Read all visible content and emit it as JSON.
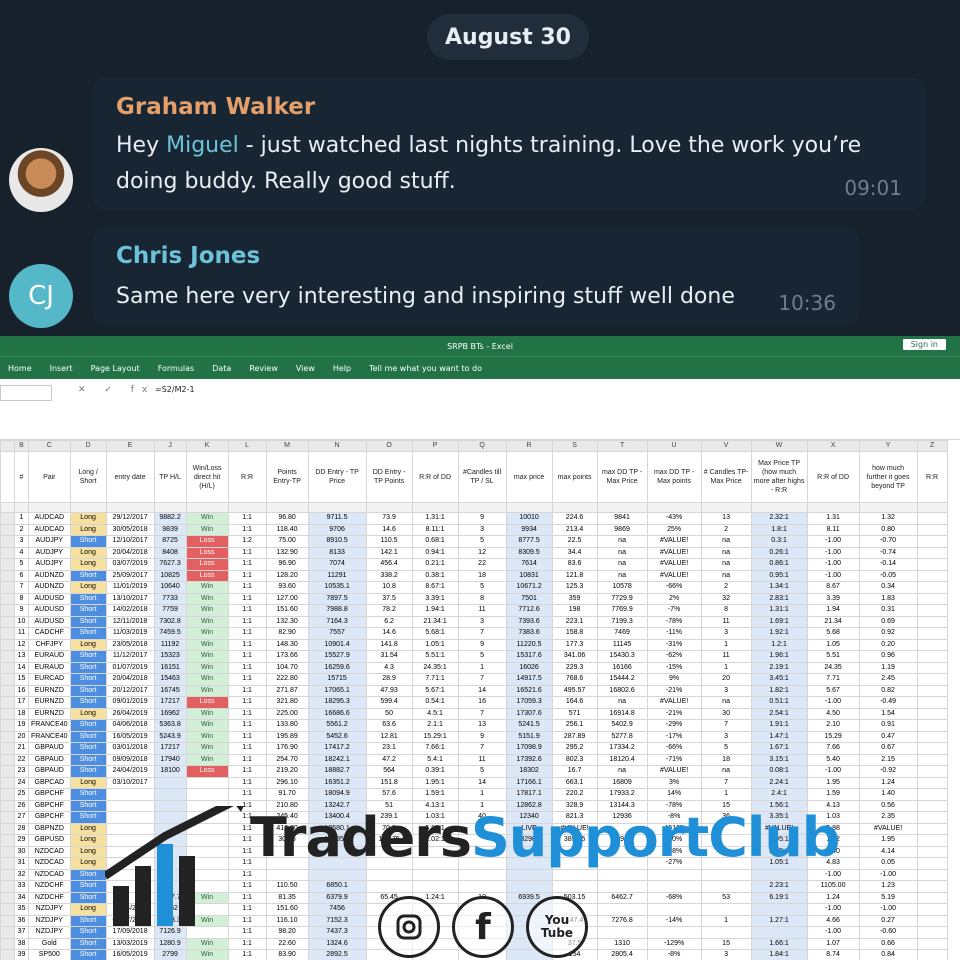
{
  "chat": {
    "date": "August 30",
    "messages": [
      {
        "sender": "Graham Walker",
        "text_before": "Hey ",
        "mention": "Miguel",
        "text_after": " - just watched last nights training. Love the work you’re doing buddy. Really good stuff.",
        "time": "09:01"
      },
      {
        "sender": "Chris Jones",
        "avatar_initials": "CJ",
        "text": "Same here very interesting and inspiring stuff well done",
        "time": "10:36"
      }
    ]
  },
  "excel": {
    "title": "SRPB BTs  -  Excel",
    "signin": "Sign in",
    "ribbon_tabs": [
      "Home",
      "Insert",
      "Page Layout",
      "Formulas",
      "Data",
      "Review",
      "View",
      "Help",
      "Tell me what you want to do"
    ],
    "formula": "=S2/M2-1",
    "fx_icons": "✕ ✓ fx",
    "column_letters": [
      "B",
      "C",
      "D",
      "E",
      "J",
      "K",
      "L",
      "M",
      "N",
      "O",
      "P",
      "Q",
      "R",
      "S",
      "T",
      "U",
      "V",
      "W",
      "X",
      "Y",
      "Z"
    ],
    "headers": [
      "#",
      "Pair",
      "Long / Short",
      "entry date",
      "TP H/L",
      "Win/Loss direct hit (H/L)",
      "R:R",
      "Points Entry-TP",
      "DD Entry - TP Price",
      "DD Entry - TP Points",
      "R:R of DD",
      "#Candles till TP / SL",
      "max price",
      "max points",
      "max DD TP - Max Price",
      "max DD TP - Max points",
      "# Candles TP-Max Price",
      "Max Price TP (how much more after highs - R:R",
      "R:R of DD",
      "how much further it goes beyond TP",
      "R:R"
    ],
    "rows": [
      [
        "1",
        "AUDCAD",
        "Long",
        "29/12/2017",
        "9882.2",
        "Win",
        "1:1",
        "96.80",
        "9711.5",
        "73.9",
        "1.31:1",
        "9",
        "10010",
        "224.6",
        "9841",
        "-43%",
        "13",
        "2.32:1",
        "1.31",
        "1.32"
      ],
      [
        "2",
        "AUDCAD",
        "Long",
        "30/05/2018",
        "9839",
        "Win",
        "1:1",
        "118.40",
        "9706",
        "14.6",
        "8.11:1",
        "3",
        "9934",
        "213.4",
        "9869",
        "25%",
        "2",
        "1.8:1",
        "8.11",
        "0.80"
      ],
      [
        "3",
        "AUDJPY",
        "Short",
        "12/10/2017",
        "8725",
        "Loss",
        "1:2",
        "75.00",
        "8910.5",
        "110.5",
        "0.68:1",
        "5",
        "8777.5",
        "22.5",
        "na",
        "#VALUE!",
        "na",
        "0.3:1",
        "-1.00",
        "-0.70"
      ],
      [
        "4",
        "AUDJPY",
        "Long",
        "20/04/2018",
        "8408",
        "Loss",
        "1:1",
        "132.90",
        "8133",
        "142.1",
        "0.94:1",
        "12",
        "8309.5",
        "34.4",
        "na",
        "#VALUE!",
        "na",
        "0.26:1",
        "-1.00",
        "-0.74"
      ],
      [
        "5",
        "AUDJPY",
        "Long",
        "03/07/2019",
        "7627.3",
        "Loss",
        "1:1",
        "96.90",
        "7074",
        "456.4",
        "0.21:1",
        "22",
        "7614",
        "83.6",
        "na",
        "#VALUE!",
        "na",
        "0.86:1",
        "-1.00",
        "-0.14"
      ],
      [
        "6",
        "AUDNZD",
        "Short",
        "25/09/2017",
        "10825",
        "Loss",
        "1:1",
        "128.20",
        "11291",
        "338.2",
        "0.38:1",
        "18",
        "10831",
        "121.8",
        "na",
        "#VALUE!",
        "na",
        "0.95:1",
        "-1.00",
        "-0.05"
      ],
      [
        "7",
        "AUDNZD",
        "Long",
        "11/01/2019",
        "10640",
        "Win",
        "1:1",
        "93.60",
        "10535.1",
        "10.8",
        "8.67:1",
        "5",
        "10671.2",
        "125.3",
        "10578",
        "-66%",
        "2",
        "1.34:1",
        "8.67",
        "0.34"
      ],
      [
        "8",
        "AUDUSD",
        "Short",
        "13/10/2017",
        "7733",
        "Win",
        "1:1",
        "127.00",
        "7897.5",
        "37.5",
        "3.39:1",
        "8",
        "7501",
        "359",
        "7729.9",
        "2%",
        "32",
        "2.83:1",
        "3.39",
        "1.83"
      ],
      [
        "9",
        "AUDUSD",
        "Short",
        "14/02/2018",
        "7759",
        "Win",
        "1:1",
        "151.60",
        "7988.8",
        "78.2",
        "1.94:1",
        "11",
        "7712.6",
        "198",
        "7769.9",
        "-7%",
        "8",
        "1.31:1",
        "1.94",
        "0.31"
      ],
      [
        "10",
        "AUDUSD",
        "Short",
        "12/11/2018",
        "7302.8",
        "Win",
        "1:1",
        "132.30",
        "7164.3",
        "6.2",
        "21.34:1",
        "3",
        "7393.6",
        "223.1",
        "7199.3",
        "-78%",
        "11",
        "1.69:1",
        "21.34",
        "0.69"
      ],
      [
        "11",
        "CADCHF",
        "Short",
        "11/03/2019",
        "7459.5",
        "Win",
        "1:1",
        "82.90",
        "7557",
        "14.6",
        "5.68:1",
        "7",
        "7383.6",
        "158.8",
        "7469",
        "-11%",
        "3",
        "1.92:1",
        "5.68",
        "0.92"
      ],
      [
        "12",
        "CHFJPY",
        "Long",
        "23/05/2018",
        "11192",
        "Win",
        "1:1",
        "148.30",
        "10901.4",
        "141.8",
        "1.05:1",
        "9",
        "11220.5",
        "177.3",
        "11145",
        "-31%",
        "1",
        "1.2:1",
        "1.05",
        "0.20"
      ],
      [
        "13",
        "EURAUD",
        "Short",
        "11/12/2017",
        "15323",
        "Win",
        "1:1",
        "173.66",
        "15527.9",
        "31.54",
        "5.51:1",
        "5",
        "15317.6",
        "341.06",
        "15430.3",
        "-62%",
        "11",
        "1.96:1",
        "5.51",
        "0.96"
      ],
      [
        "14",
        "EURAUD",
        "Short",
        "01/07/2019",
        "16151",
        "Win",
        "1:1",
        "104.70",
        "16259.6",
        "4.3",
        "24.35:1",
        "1",
        "16026",
        "229.3",
        "16166",
        "-15%",
        "1",
        "2.19:1",
        "24.35",
        "1.19"
      ],
      [
        "15",
        "EURCAD",
        "Short",
        "20/04/2018",
        "15463",
        "Win",
        "1:1",
        "222.80",
        "15715",
        "28.9",
        "7.71:1",
        "7",
        "14917.5",
        "768.6",
        "15444.2",
        "9%",
        "20",
        "3.45:1",
        "7.71",
        "2.45"
      ],
      [
        "16",
        "EURNZD",
        "Short",
        "20/12/2017",
        "16745",
        "Win",
        "1:1",
        "271.87",
        "17065.1",
        "47.93",
        "5.67:1",
        "14",
        "16521.6",
        "495.57",
        "16802.6",
        "-21%",
        "3",
        "1.82:1",
        "5.67",
        "0.82"
      ],
      [
        "17",
        "EURNZD",
        "Short",
        "09/01/2019",
        "17217",
        "Loss",
        "1:1",
        "321.80",
        "18295.3",
        "599.4",
        "0.54:1",
        "16",
        "17059.3",
        "164.6",
        "na",
        "#VALUE!",
        "na",
        "0.51:1",
        "-1.00",
        "-0.49"
      ],
      [
        "18",
        "EURNZD",
        "Long",
        "26/04/2019",
        "16962",
        "Win",
        "1:1",
        "225.00",
        "16686.6",
        "50",
        "4.5:1",
        "7",
        "17307.6",
        "571",
        "16914.8",
        "-21%",
        "30",
        "2.54:1",
        "4.50",
        "1.54"
      ],
      [
        "19",
        "FRANCE40",
        "Short",
        "04/06/2018",
        "5363.8",
        "Win",
        "1:1",
        "133.80",
        "5561.2",
        "63.6",
        "2.1:1",
        "13",
        "5241.5",
        "256.1",
        "5402.9",
        "-29%",
        "7",
        "1.91:1",
        "2.10",
        "0.91"
      ],
      [
        "20",
        "FRANCE40",
        "Short",
        "16/05/2019",
        "5243.9",
        "Win",
        "1:1",
        "195.89",
        "5452.6",
        "12.81",
        "15.29:1",
        "9",
        "5151.9",
        "287.89",
        "5277.8",
        "-17%",
        "3",
        "1.47:1",
        "15.29",
        "0.47"
      ],
      [
        "21",
        "GBPAUD",
        "Short",
        "03/01/2018",
        "17217",
        "Win",
        "1:1",
        "176.90",
        "17417.2",
        "23.1",
        "7.66:1",
        "7",
        "17098.9",
        "295.2",
        "17334.2",
        "-66%",
        "5",
        "1.67:1",
        "7.66",
        "0.67"
      ],
      [
        "22",
        "GBPAUD",
        "Short",
        "09/09/2018",
        "17940",
        "Win",
        "1:1",
        "254.70",
        "18242.1",
        "47.2",
        "5.4:1",
        "11",
        "17392.6",
        "802.3",
        "18120.4",
        "-71%",
        "18",
        "3.15:1",
        "5.40",
        "2.15"
      ],
      [
        "23",
        "GBPAUD",
        "Short",
        "24/04/2019",
        "18100",
        "Loss",
        "1:1",
        "219.20",
        "18882.7",
        "564",
        "0.39:1",
        "5",
        "18302",
        "16.7",
        "na",
        "#VALUE!",
        "na",
        "0.08:1",
        "-1.00",
        "-0.92"
      ],
      [
        "24",
        "GBPCAD",
        "Long",
        "03/10/2017",
        "",
        "",
        "1:1",
        "296.10",
        "16351.2",
        "151.8",
        "1.95:1",
        "14",
        "17166.1",
        "663.1",
        "16809",
        "3%",
        "7",
        "2.24:1",
        "1.95",
        "1.24"
      ],
      [
        "25",
        "GBPCHF",
        "Short",
        "",
        "",
        "",
        "1:1",
        "91.70",
        "18094.9",
        "57.6",
        "1.59:1",
        "1",
        "17817.1",
        "220.2",
        "17933.2",
        "14%",
        "1",
        "2.4:1",
        "1.59",
        "1.40"
      ],
      [
        "26",
        "GBPCHF",
        "Short",
        "",
        "",
        "",
        "1:1",
        "210.80",
        "13242.7",
        "51",
        "4.13:1",
        "1",
        "12862.8",
        "328.9",
        "13144.3",
        "-78%",
        "15",
        "1.56:1",
        "4.13",
        "0.56"
      ],
      [
        "27",
        "GBPCHF",
        "Short",
        "",
        "",
        "",
        "1:1",
        "245.40",
        "13400.4",
        "239.1",
        "1.03:1",
        "40",
        "12340",
        "821.3",
        "12936",
        "-8%",
        "36",
        "3.35:1",
        "1.03",
        "2.35"
      ],
      [
        "28",
        "GBPNZD",
        "Long",
        "",
        "",
        "",
        "1:1",
        "413.30",
        "18580.1",
        "70.3",
        "5.88:1",
        "9",
        "LIVE",
        "#VALUE!",
        "",
        "-4613%",
        "",
        "#VALUE!",
        "5.88",
        "#VALUE!"
      ],
      [
        "29",
        "GBPUSD",
        "Long",
        "",
        "",
        "",
        "1:1",
        "30.55",
        "12785.5",
        "127.75",
        "1.02:1",
        "",
        "13298.7",
        "385.45",
        "12965",
        "-60%",
        "",
        "2.95:1",
        "1.02",
        "1.95"
      ],
      [
        "30",
        "NZDCAD",
        "Long",
        "",
        "",
        "",
        "1:1",
        "",
        "",
        "",
        "",
        "",
        "",
        "",
        "",
        "-28%",
        "",
        "2.40:1",
        "2.40",
        "4.14"
      ],
      [
        "31",
        "NZDCAD",
        "Long",
        "",
        "",
        "",
        "1:1",
        "",
        "",
        "",
        "",
        "",
        "",
        "",
        "",
        "-27%",
        "",
        "1.05:1",
        "4.83",
        "0.05"
      ],
      [
        "32",
        "NZDCAD",
        "Short",
        "",
        "",
        "",
        "1:1",
        "",
        "",
        "",
        "",
        "",
        "",
        "",
        "",
        "",
        "",
        "",
        "-1.00",
        "-1.00"
      ],
      [
        "33",
        "NZDCHF",
        "Short",
        "",
        "",
        "",
        "1:1",
        "110.50",
        "6850.1",
        "",
        "",
        "",
        "",
        "",
        "",
        "",
        "",
        "2.23:1",
        "1105.00",
        "1.23"
      ],
      [
        "34",
        "NZDCHF",
        "Short",
        "",
        "6517.7",
        "Win",
        "1:1",
        "81.35",
        "6379.9",
        "65.45",
        "1.24:1",
        "10",
        "6939.5",
        "503.15",
        "6462.7",
        "-68%",
        "53",
        "6.19:1",
        "1.24",
        "5.19"
      ],
      [
        "35",
        "NZDJPY",
        "Long",
        "19/04/2018",
        "7962",
        "",
        "1:1",
        "151.60",
        "7456",
        "",
        "",
        "",
        "",
        "",
        "",
        "",
        "",
        "",
        "-1.00",
        "-1.00"
      ],
      [
        "36",
        "NZDJPY",
        "Short",
        "05/07/2019",
        "7293.3",
        "Win",
        "1:1",
        "116.10",
        "7152.3",
        "",
        "",
        "",
        "",
        "147.4",
        "7276.8",
        "-14%",
        "1",
        "1.27:1",
        "4.66",
        "0.27"
      ],
      [
        "37",
        "NZDJPY",
        "Short",
        "17/09/2018",
        "7126.9",
        "",
        "1:1",
        "98.20",
        "7437.3",
        "",
        "",
        "",
        "",
        "",
        "",
        "",
        "",
        "",
        "-1.00",
        "-0.60"
      ],
      [
        "38",
        "Gold",
        "Short",
        "13/03/2019",
        "1280.9",
        "Win",
        "1:1",
        "22.60",
        "1324.6",
        "",
        "",
        "",
        "",
        "37.5",
        "1310",
        "-129%",
        "15",
        "1.66:1",
        "1.07",
        "0.66"
      ],
      [
        "39",
        "SP500",
        "Short",
        "16/05/2019",
        "2799",
        "Win",
        "1:1",
        "83.90",
        "2892.5",
        "",
        "",
        "",
        "",
        "154",
        "2805.4",
        "-8%",
        "3",
        "1.84:1",
        "8.74",
        "0.84"
      ]
    ]
  },
  "watermark": {
    "brand_a": "Traders",
    "brand_b": "SupportClub",
    "social": [
      "instagram-icon",
      "facebook-icon",
      "youtube-icon"
    ],
    "social_labels": [
      "",
      "f",
      "You Tube"
    ]
  }
}
